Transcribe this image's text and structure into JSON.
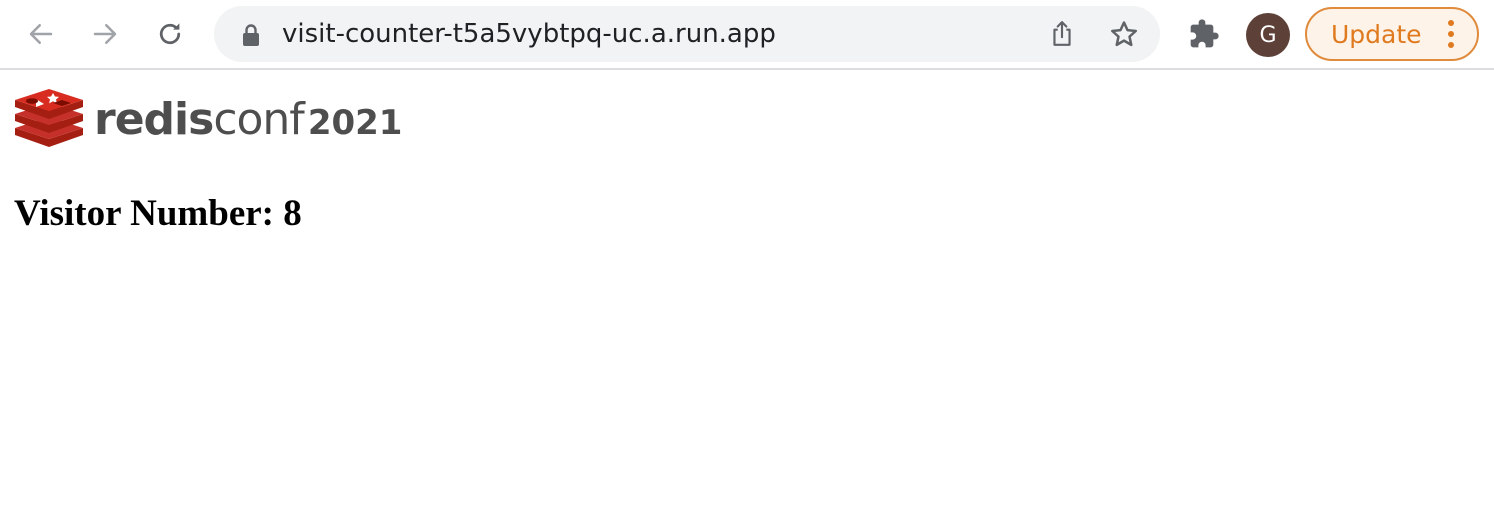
{
  "browser": {
    "url": "visit-counter-t5a5vybtpq-uc.a.run.app",
    "profile_initial": "G",
    "update_label": "Update",
    "icons": {
      "back": "arrow-left-icon",
      "forward": "arrow-right-icon",
      "reload": "reload-icon",
      "lock": "lock-icon",
      "share": "share-icon",
      "bookmark": "star-icon",
      "extensions": "puzzle-icon",
      "menu": "kebab-menu-icon"
    },
    "colors": {
      "update_accent": "#e07a1f",
      "avatar_bg": "#5d4037"
    }
  },
  "page": {
    "logo": {
      "word_bold": "redis",
      "word_light": "conf",
      "year": "2021",
      "brand_color": "#c6302b"
    },
    "heading": "Visitor Number: 8"
  }
}
